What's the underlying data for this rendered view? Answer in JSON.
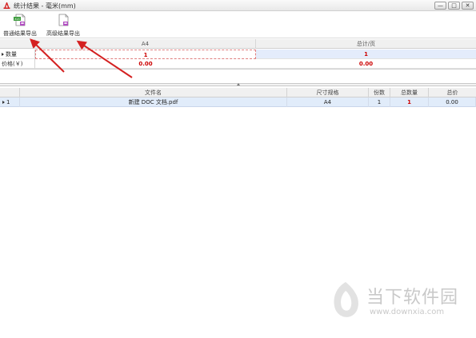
{
  "window": {
    "title": "统计结果 - 毫米(mm)",
    "controls": {
      "minimize": "—",
      "maximize": "□",
      "close": "✕"
    }
  },
  "toolbar": {
    "normal_export_label": "普通结果导出",
    "advanced_export_label": "高级结果导出"
  },
  "summary": {
    "columns": [
      "A4",
      "总计/页"
    ],
    "rows": [
      {
        "label": "数量",
        "values": [
          "1",
          "1"
        ]
      },
      {
        "label": "价格(￥)",
        "values": [
          "0.00",
          "0.00"
        ]
      }
    ]
  },
  "files": {
    "headers": [
      "文件名",
      "尺寸规格",
      "份数",
      "总数量",
      "总价"
    ],
    "rows": [
      {
        "index": "1",
        "name": "新建 DOC 文档.pdf",
        "size": "A4",
        "copies": "1",
        "total_qty": "1",
        "total_price": "0.00"
      }
    ]
  },
  "watermark": {
    "text": "当下软件园",
    "url": "www.downxia.com"
  },
  "colors": {
    "accent_red": "#cc0000",
    "selection_blue": "#e1ecfa",
    "arrow_red": "#d42020"
  }
}
